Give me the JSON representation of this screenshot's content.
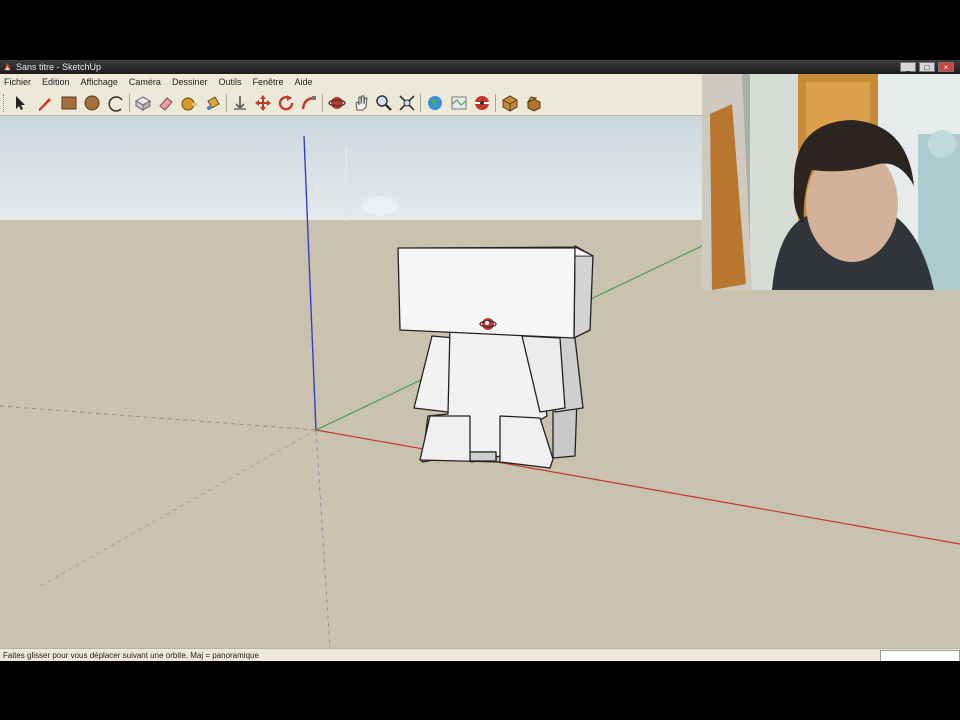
{
  "window": {
    "title": "Sans titre - SketchUp",
    "controls": {
      "minimize": "_",
      "maximize": "□",
      "close": "×"
    }
  },
  "menu": {
    "items": [
      "Fichier",
      "Edition",
      "Affichage",
      "Caméra",
      "Dessiner",
      "Outils",
      "Fenêtre",
      "Aide"
    ]
  },
  "toolbar": {
    "tools": [
      {
        "name": "select",
        "icon": "arrow-icon"
      },
      {
        "name": "pencil",
        "icon": "pencil-icon"
      },
      {
        "name": "rectangle",
        "icon": "rectangle-icon"
      },
      {
        "name": "circle",
        "icon": "circle-icon"
      },
      {
        "name": "arc",
        "icon": "arc-icon"
      },
      {
        "name": "make-component",
        "icon": "component-icon"
      },
      {
        "name": "eraser",
        "icon": "eraser-icon"
      },
      {
        "name": "tape-measure",
        "icon": "tape-icon"
      },
      {
        "name": "paint-bucket",
        "icon": "bucket-icon"
      },
      {
        "name": "push-pull",
        "icon": "pushpull-icon"
      },
      {
        "name": "move",
        "icon": "move-icon"
      },
      {
        "name": "rotate",
        "icon": "rotate-icon"
      },
      {
        "name": "follow-me",
        "icon": "followme-icon"
      },
      {
        "name": "orbit",
        "icon": "orbit-icon"
      },
      {
        "name": "pan",
        "icon": "pan-icon"
      },
      {
        "name": "zoom",
        "icon": "zoom-icon"
      },
      {
        "name": "zoom-extents",
        "icon": "zoom-extents-icon"
      },
      {
        "name": "get-models",
        "icon": "globe-icon"
      },
      {
        "name": "share-model",
        "icon": "map-icon"
      },
      {
        "name": "get-photo-texture",
        "icon": "photo-icon"
      },
      {
        "name": "components-window",
        "icon": "box-icon"
      },
      {
        "name": "extension-warehouse",
        "icon": "box-open-icon"
      }
    ]
  },
  "status": {
    "hint": "Faites glisser pour vous déplacer suivant une orbite. Maj = panoramique"
  },
  "colors": {
    "sky": "#d9e3e6",
    "ground": "#c9c2ae",
    "red_axis": "#c0392b",
    "green_axis": "#3f9a3f",
    "blue_axis": "#3340c8",
    "model_face": "#f2f2f2"
  }
}
